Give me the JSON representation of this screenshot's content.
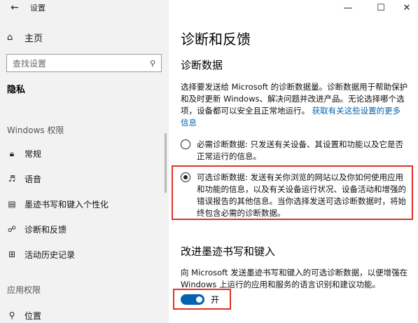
{
  "window": {
    "title": "设置",
    "back_icon": "←",
    "minimize": "—",
    "maximize": "☐",
    "close": "✕"
  },
  "sidebar": {
    "home_label": "主页",
    "search_placeholder": "查找设置",
    "section": "隐私",
    "group_windows": "Windows 权限",
    "items": [
      {
        "label": "常规",
        "icon": "lock-icon",
        "glyph": "🔒︎"
      },
      {
        "label": "语音",
        "icon": "speech-icon",
        "glyph": "♬"
      },
      {
        "label": "墨迹书写和键入个性化",
        "icon": "clipboard-icon",
        "glyph": "▤"
      },
      {
        "label": "诊断和反馈",
        "icon": "feedback-icon",
        "glyph": "☍"
      },
      {
        "label": "活动历史记录",
        "icon": "timeline-icon",
        "glyph": "⊞"
      }
    ],
    "group_app": "应用权限",
    "items2": [
      {
        "label": "位置",
        "icon": "location-icon",
        "glyph": "⚲"
      }
    ]
  },
  "main": {
    "title": "诊断和反馈",
    "diag_heading": "诊断数据",
    "diag_desc": "选择要发送给 Microsoft 的诊断数据量。诊断数据用于帮助保护和及时更新 Windows、解决问题并改进产品。无论选择哪个选项，设备都可以安全且正常地运行。",
    "diag_link": "获取有关这些设置的更多信息",
    "option_required": "必需诊断数据: 只发送有关设备、其设置和功能以及它是否正常运行的信息。",
    "option_optional": "可选诊断数据: 发送有关你浏览的网站以及你如何使用应用和功能的信息，以及有关设备运行状况、设备活动和增强的错误报告的其他信息。当你选择发送可选诊断数据时，将始终包含必需的诊断数据。",
    "ink_heading": "改进墨迹书写和键入",
    "ink_desc": "向 Microsoft 发送墨迹书写和键入的可选诊断数据，以便增强在 Windows 上运行的应用和服务的语言识别和建议功能。",
    "toggle_label": "开"
  },
  "colors": {
    "accent": "#0063b1",
    "highlight": "#e0312b",
    "sidebar_bg": "#f2f2f2"
  }
}
